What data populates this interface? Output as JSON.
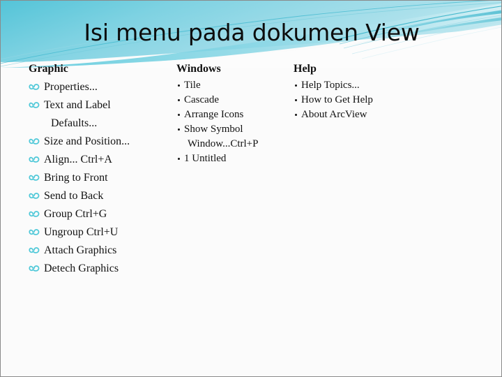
{
  "slide": {
    "title": "Isi menu pada dokumen View",
    "background_color": "#fbfbfb",
    "accent_color": "#5ec8dd",
    "banner_colors": {
      "deep_teal": "#39b7cd",
      "mid_teal": "#6ecfe0",
      "light_teal": "#a9e2ec",
      "pale_teal": "#cceff4",
      "ribbon_line": "#2fb3c9"
    },
    "bullet_icon_color": "#4ec8d8"
  },
  "columns": [
    {
      "id": "graphic",
      "header": "Graphic",
      "bullet_style": "ornament",
      "items": [
        {
          "label": "Properties..."
        },
        {
          "label": "Text and Label",
          "wrapped_line": "Defaults..."
        },
        {
          "label": "Size and Position..."
        },
        {
          "label": "Align... Ctrl+A"
        },
        {
          "label": "Bring to Front"
        },
        {
          "label": "Send to Back"
        },
        {
          "label": "Group Ctrl+G"
        },
        {
          "label": "Ungroup Ctrl+U"
        },
        {
          "label": "Attach Graphics"
        },
        {
          "label": "Detech Graphics"
        }
      ]
    },
    {
      "id": "windows",
      "header": "Windows",
      "bullet_style": "dot",
      "items": [
        {
          "label": "Tile"
        },
        {
          "label": "Cascade"
        },
        {
          "label": "Arrange Icons"
        },
        {
          "label": "Show Symbol",
          "wrapped_line": "Window...Ctrl+P"
        },
        {
          "label": "1 Untitled"
        }
      ]
    },
    {
      "id": "help",
      "header": "Help",
      "bullet_style": "dot",
      "items": [
        {
          "label": "Help Topics..."
        },
        {
          "label": "How to Get Help"
        },
        {
          "label": "About ArcView"
        }
      ]
    }
  ]
}
